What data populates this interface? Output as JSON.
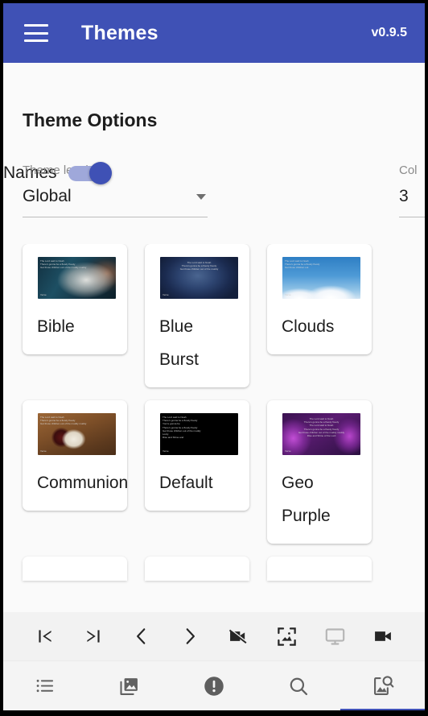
{
  "appbar": {
    "menu_icon": "hamburger-menu-icon",
    "title": "Themes",
    "version": "v0.9.5",
    "background_color": "#3f51b5",
    "text_color": "#ffffff"
  },
  "content": {
    "section_title": "Theme Options",
    "theme_level": {
      "label": "Theme level",
      "value": "Global",
      "dropdown_icon": "chevron-down-icon"
    },
    "names_toggle": {
      "label": "Names",
      "state": "on",
      "track_color": "#9fa8da",
      "thumb_color": "#3f51b5"
    },
    "columns": {
      "label": "Col",
      "value": "3"
    }
  },
  "themes": {
    "rows": [
      [
        {
          "name": "Bible",
          "thumb_class": "th-bible",
          "wrap": false,
          "thumb_text": "The Lord said to Noah\nThere's gonna be a floody floody\nGet those children out of the muddy muddy",
          "thumb_foot": "Verse"
        },
        {
          "name": "Blue Burst",
          "thumb_class": "th-blueburst",
          "wrap": true,
          "thumb_text": "The Lord said to Noah\nThere's gonna be a floody floody\nGet those children out of the muddy",
          "thumb_foot": "Verse"
        },
        {
          "name": "Clouds",
          "thumb_class": "th-clouds",
          "wrap": false,
          "thumb_text": "The Lord said to Noah\nThere's gonna be a floody floody\nGet those children out",
          "thumb_foot": "Verse"
        }
      ],
      [
        {
          "name": "Communion",
          "thumb_class": "th-communion",
          "wrap": false,
          "thumb_text": "The Lord said to Noah\nThere's gonna be a floody floody\nGet those children out of the muddy muddy",
          "thumb_foot": "Verse"
        },
        {
          "name": "Default",
          "thumb_class": "th-default",
          "wrap": false,
          "thumb_text": "The Lord said to Noah\nThere's gonna be a floody floody\nYou're gonna be\nThere's gonna be a floody floody\nGet those children out of the muddy\nLordy\nRise and Shine and",
          "thumb_foot": "Verse"
        },
        {
          "name": "Geo Purple",
          "thumb_class": "th-geopurple",
          "wrap": true,
          "thumb_text": "The Lord said to Noah\nThere's gonna be a floody floody\nThe Lord said to Noah\nThere's gonna be a floody floody\nGet those children out of the muddy muddy\nRise and Shine of the Lord",
          "thumb_foot": "Verse"
        }
      ]
    ],
    "partial_row_count": 3
  },
  "media_toolbar": {
    "buttons": [
      {
        "icon": "skip-to-first-icon",
        "enabled": true
      },
      {
        "icon": "skip-to-last-icon",
        "enabled": true
      },
      {
        "icon": "chevron-left-icon",
        "enabled": true
      },
      {
        "icon": "chevron-right-icon",
        "enabled": true
      },
      {
        "icon": "videocam-off-icon",
        "enabled": true
      },
      {
        "icon": "image-frame-icon",
        "enabled": true
      },
      {
        "icon": "monitor-icon",
        "enabled": false
      },
      {
        "icon": "videocam-icon",
        "enabled": true
      }
    ]
  },
  "bottom_nav": {
    "items": [
      {
        "icon": "list-icon",
        "active": false
      },
      {
        "icon": "photo-library-icon",
        "active": false
      },
      {
        "icon": "alert-circle-icon",
        "active": false
      },
      {
        "icon": "search-icon",
        "active": false
      },
      {
        "icon": "image-search-icon",
        "active": true
      }
    ],
    "active_indicator_color": "#3f51b5"
  }
}
